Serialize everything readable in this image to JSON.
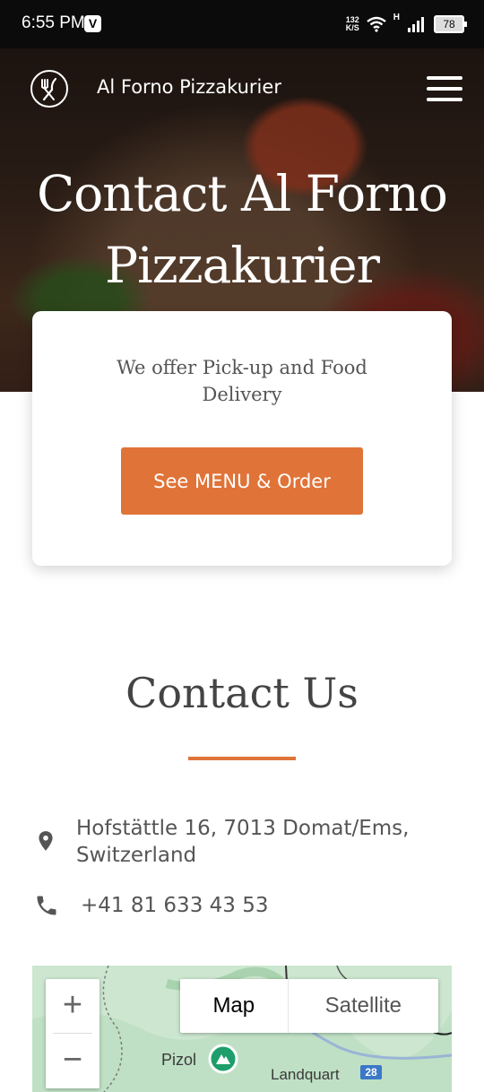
{
  "status_bar": {
    "time": "6:55 PM",
    "app_badge": "V",
    "net_speed_value": "132",
    "net_speed_unit": "K/S",
    "network_type": "H",
    "battery": "78"
  },
  "header": {
    "brand_name": "Al Forno Pizzakurier",
    "logo_icon": "fork-knife-icon",
    "menu_icon": "hamburger-icon"
  },
  "hero": {
    "title": "Contact Al Forno Pizzakurier"
  },
  "card": {
    "text": "We offer Pick-up and Food Delivery",
    "button_label": "See MENU & Order",
    "button_color": "#e07338"
  },
  "contact": {
    "title": "Contact Us",
    "address_line1": "Hofstättle 16, 7013 Domat/Ems,",
    "address_line2": "Switzerland",
    "phone": "+41 81 633 43 53"
  },
  "map": {
    "zoom_in": "+",
    "zoom_out": "−",
    "type_map": "Map",
    "type_satellite": "Satellite",
    "place_1": "Pizol",
    "place_2": "Landquart",
    "road_number": "28"
  }
}
